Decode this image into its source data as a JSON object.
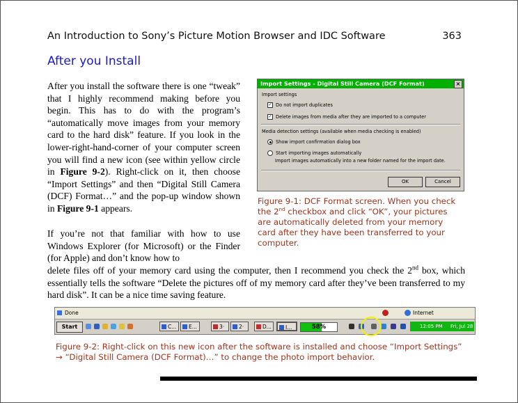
{
  "header": {
    "title": "An Introduction to Sony’s Picture Motion Browser and IDC Software",
    "page_number": "363"
  },
  "section_title": "After you Install",
  "paragraph1": {
    "t1": "After you install the software there is one “tweak” that I highly recommend making before you begin.  This has to do with the program’s “automatically move images from your memory card to the hard disk” feature.  If you look in the lower-right-hand-corner of your computer screen you will find a new icon (see within yellow circle in ",
    "ref1": "Figure 9-2",
    "t2": ").  Right-click on it, then choose “Import Settings” and then “Digital Still Camera (DCF) Format…” and the pop-up window shown in ",
    "ref2": "Figure 9-1",
    "t3": " appears."
  },
  "paragraph2": {
    "part1": "If you’re not that familiar with how to use Windows Explorer (for Microsoft) or the Finder (for Apple) and don’t know how to",
    "part2a": "delete files off of your memory card using the computer, then I recommend you check the 2",
    "sup": "nd",
    "part2b": " box, which essentially tells the software “Delete the pictures off of my memory card after they’ve been transferred to my hard disk”.  It can be a nice time saving feature."
  },
  "dialog": {
    "title": "Import Settings - Digital Still Camera (DCF Format)",
    "close": "×",
    "group1_label": "Import settings",
    "checkbox1": "Do not import duplicates",
    "checkbox2": "Delete images from media after they are imported to a computer",
    "group2_label": "Media detection settings (available when media checking is enabled)",
    "radio1": "Show import confirmation dialog box",
    "radio2": "Start importing images automatically",
    "radio2_desc": "Import images automatically into a new folder named for the import date.",
    "ok": "OK",
    "cancel": "Cancel",
    "check_mark": "✓"
  },
  "caption1": {
    "label": "Figure 9-1:",
    "t1": "  DCF Format screen.  When you check the 2",
    "sup": "nd",
    "t2": " checkbox and click “OK”, your pictures are automatically deleted from your memory card after they have been transferred to your computer."
  },
  "taskbar": {
    "status_done": "Done",
    "status_zone": "Internet",
    "start": "Start",
    "tasks": [
      "C...",
      "E...",
      "3·",
      "2·",
      "D...",
      "I..."
    ],
    "progress_pct": 58,
    "progress_label": "58%",
    "clock_time": "12:05 PM",
    "clock_date": "Fri, Jul 28",
    "colors": {
      "clock_bg": "#11b611",
      "progress_fill": "#11c011",
      "highlight": "#f3f000"
    }
  },
  "caption2": {
    "label": "Figure 9-2:",
    "text": "  Right-click on this new icon after the software is installed and choose “Import Settings” → “Digital Still Camera (DCF Format)…” to change the photo import behavior."
  }
}
